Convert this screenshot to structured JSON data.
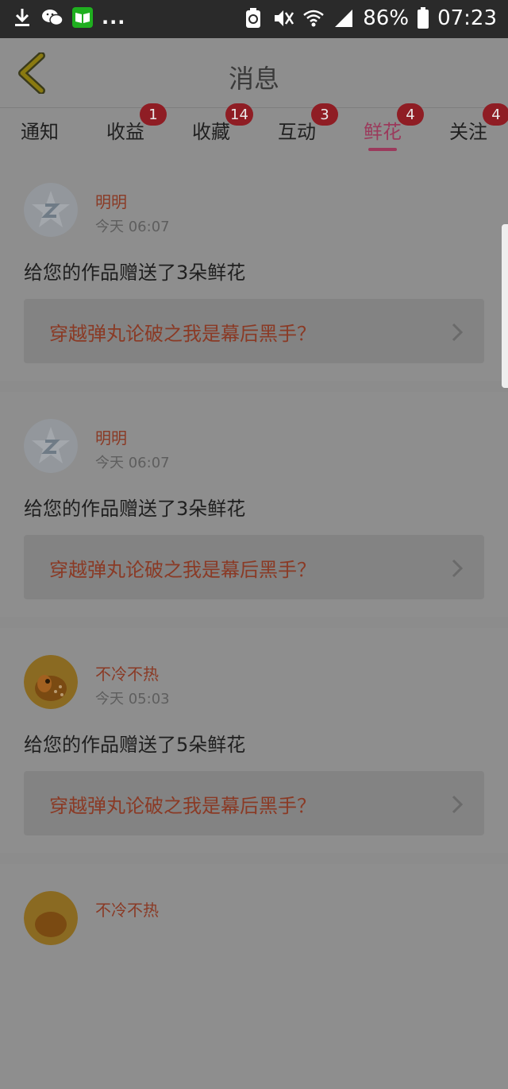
{
  "status_bar": {
    "battery": "86%",
    "time": "07:23",
    "icons_left": [
      "download-icon",
      "wechat-icon",
      "book-app-icon",
      "more-dots"
    ],
    "icons_right": [
      "recycle-icon",
      "mute-icon",
      "wifi-icon",
      "signal-icon",
      "battery-icon"
    ]
  },
  "header": {
    "title": "消息"
  },
  "tabs": [
    {
      "label": "通知",
      "badge": ""
    },
    {
      "label": "收益",
      "badge": "1"
    },
    {
      "label": "收藏",
      "badge": "14"
    },
    {
      "label": "互动",
      "badge": "3"
    },
    {
      "label": "鲜花",
      "badge": "4",
      "active": true
    },
    {
      "label": "关注",
      "badge": "4"
    }
  ],
  "feed": [
    {
      "name": "明明",
      "time": "今天 06:07",
      "message": "给您的作品赠送了3朵鲜花",
      "work": "穿越弹丸论破之我是幕后黑手？",
      "avatar": "qq-default"
    },
    {
      "name": "明明",
      "time": "今天 06:07",
      "message": "给您的作品赠送了3朵鲜花",
      "work": "穿越弹丸论破之我是幕后黑手？",
      "avatar": "qq-default"
    },
    {
      "name": "不冷不热",
      "time": "今天 05:03",
      "message": "给您的作品赠送了5朵鲜花",
      "work": "穿越弹丸论破之我是幕后黑手？",
      "avatar": "deer"
    },
    {
      "name": "不冷不热",
      "time": "",
      "message": "",
      "work": "",
      "avatar": "deer"
    }
  ],
  "colors": {
    "accent": "#9b3a5c",
    "badge": "#8f1d24",
    "name": "#8a3a25"
  }
}
